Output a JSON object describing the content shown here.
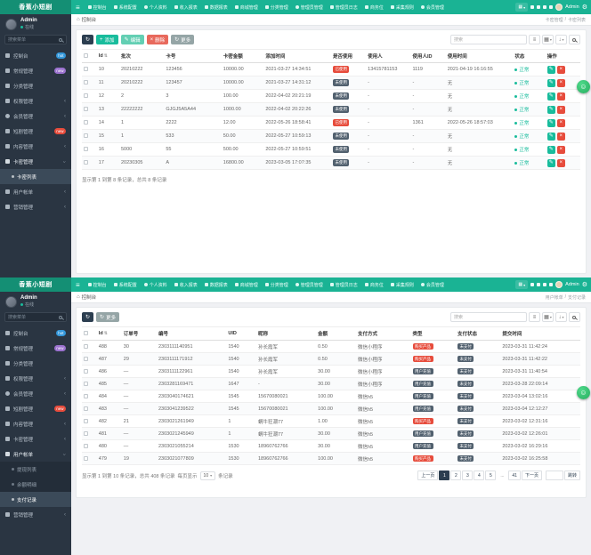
{
  "brand": "香蕉小短剧",
  "theme": {
    "header_teal": "#1ab394",
    "brand_dark": "#148f74",
    "sidebar_dark": "#2a3542",
    "accent_green": "#18bc9c",
    "danger_red": "#e74c3c",
    "navy": "#2c3e50",
    "gray_button": "#95a5a6",
    "badge_blue": "#3498db",
    "badge_purple": "#9b72cf",
    "badge_dark": "#51606e"
  },
  "icons": {
    "chevron": "‹",
    "sort": "⇅",
    "refresh": "↻",
    "plus": "+",
    "pencil": "✎",
    "close": "×",
    "trash": "×",
    "toggle": "≡",
    "columns": "▦",
    "export": "↓",
    "caret": "▾",
    "home": "⌂",
    "gear": "⚙",
    "grid": "▦",
    "smile": "☺",
    "collapse": "≡"
  },
  "topnav": {
    "items": [
      {
        "icon": "home",
        "label": "控制台"
      },
      {
        "icon": "gear",
        "label": "系统配置"
      },
      {
        "icon": "user",
        "label": "个人资料",
        "round": true
      },
      {
        "icon": "chart",
        "label": "收入报表"
      },
      {
        "icon": "chart",
        "label": "数据报表"
      },
      {
        "icon": "bag",
        "label": "商城管理"
      },
      {
        "icon": "tag",
        "label": "分类管理"
      },
      {
        "icon": "admin",
        "label": "管理员管理",
        "round": true
      },
      {
        "icon": "log",
        "label": "管理员日志"
      },
      {
        "icon": "briefcase",
        "label": "商务位"
      },
      {
        "icon": "rules",
        "label": "采集规则"
      },
      {
        "icon": "member",
        "label": "会员管理",
        "round": true
      }
    ],
    "right_icons": [
      "bell",
      "envelope",
      "message",
      "fullscreen"
    ],
    "user": "Admin"
  },
  "sidebar": {
    "user": "Admin",
    "status": "在线",
    "search_placeholder": "搜索菜单"
  },
  "screens": [
    {
      "breadcrumb_left": "控制台",
      "breadcrumb_right": [
        "卡密管理",
        "卡密列表"
      ],
      "search_placeholder": "搜索",
      "sidebar_items": [
        {
          "icon": "dashboard",
          "label": "控制台",
          "badge": "hot",
          "badge_color": "blue"
        },
        {
          "icon": "gear",
          "label": "常规管理",
          "badge": "new",
          "badge_color": "purple"
        },
        {
          "icon": "send",
          "label": "分类管理"
        },
        {
          "icon": "users",
          "label": "权限管理",
          "chevron": "left"
        },
        {
          "icon": "member",
          "label": "会员管理",
          "chevron": "left",
          "round": true
        },
        {
          "icon": "video",
          "label": "短剧管理",
          "badge": "new",
          "badge_color": "red"
        },
        {
          "icon": "folder",
          "label": "内容管理",
          "chevron": "left"
        },
        {
          "icon": "card",
          "label": "卡密管理",
          "chevron": "down",
          "open": true
        },
        {
          "sub": true,
          "label": "卡密列表",
          "active": true
        },
        {
          "icon": "wallet",
          "label": "用户帐单",
          "chevron": "left"
        },
        {
          "icon": "chart",
          "label": "营销管理",
          "chevron": "left"
        }
      ],
      "toolbar": [
        {
          "icon": "refresh",
          "style": "dark"
        },
        {
          "icon": "plus",
          "label": "添加",
          "style": "success"
        },
        {
          "icon": "pencil",
          "label": "编辑",
          "style": "success-lt"
        },
        {
          "icon": "close",
          "label": "删除",
          "style": "danger"
        },
        {
          "icon": "refresh",
          "label": "更多",
          "style": "secondary"
        }
      ],
      "table": {
        "columns": [
          {
            "type": "checkbox",
            "label": "",
            "w": 3
          },
          {
            "label": "Id",
            "w": 4.5,
            "sort": true
          },
          {
            "label": "批次",
            "w": 9
          },
          {
            "label": "卡号",
            "w": 11.5
          },
          {
            "label": "卡密金额",
            "w": 8.5
          },
          {
            "label": "添加时间",
            "w": 13.5
          },
          {
            "label": "是否使用",
            "w": 7
          },
          {
            "label": "使用人",
            "w": 9
          },
          {
            "label": "使用人ID",
            "w": 7
          },
          {
            "label": "使用时间",
            "w": 13.5
          },
          {
            "label": "状态",
            "w": 6.5
          },
          {
            "label": "操作",
            "w": 7
          }
        ],
        "fields": [
          {
            "type": "checkbox"
          },
          {
            "key": "id"
          },
          {
            "key": "batch"
          },
          {
            "key": "card_no"
          },
          {
            "key": "amount"
          },
          {
            "key": "added"
          },
          {
            "type": "badge",
            "key": "used",
            "color": "used_color"
          },
          {
            "key": "user"
          },
          {
            "key": "user_id"
          },
          {
            "key": "use_time"
          },
          {
            "type": "status",
            "key": "status"
          },
          {
            "type": "actions"
          }
        ],
        "rows": [
          {
            "id": "10",
            "batch": "20210222",
            "card_no": "123456",
            "amount": "10000.00",
            "added": "2021-03-27 14:34:51",
            "used": "已使用",
            "used_color": "red",
            "user": "13415781153",
            "user_id": "1119",
            "use_time": "2021-04-19 16:16:55",
            "status": "正常"
          },
          {
            "id": "11",
            "batch": "20210222",
            "card_no": "123457",
            "amount": "10000.00",
            "added": "2021-03-27 14:31:12",
            "used": "未使用",
            "used_color": "dark",
            "user": "-",
            "user_id": "-",
            "use_time": "无",
            "status": "正常"
          },
          {
            "id": "12",
            "batch": "2",
            "card_no": "3",
            "amount": "100.00",
            "added": "2022-04-02 20:21:19",
            "used": "未使用",
            "used_color": "dark",
            "user": "-",
            "user_id": "-",
            "use_time": "无",
            "status": "正常"
          },
          {
            "id": "13",
            "batch": "22222222",
            "card_no": "GJGJ5A5A44",
            "amount": "1000.00",
            "added": "2022-04-02 20:22:26",
            "used": "未使用",
            "used_color": "dark",
            "user": "-",
            "user_id": "-",
            "use_time": "无",
            "status": "正常"
          },
          {
            "id": "14",
            "batch": "1",
            "card_no": "2222",
            "amount": "12.00",
            "added": "2022-05-26 18:58:41",
            "used": "已使用",
            "used_color": "red",
            "user": "-",
            "user_id": "1361",
            "use_time": "2022-05-26 18:57:03",
            "status": "正常"
          },
          {
            "id": "15",
            "batch": "1",
            "card_no": "533",
            "amount": "50.00",
            "added": "2022-05-27 10:59:13",
            "used": "未使用",
            "used_color": "dark",
            "user": "-",
            "user_id": "-",
            "use_time": "无",
            "status": "正常"
          },
          {
            "id": "16",
            "batch": "5000",
            "card_no": "55",
            "amount": "500.00",
            "added": "2022-05-27 10:59:51",
            "used": "未使用",
            "used_color": "dark",
            "user": "-",
            "user_id": "-",
            "use_time": "无",
            "status": "正常"
          },
          {
            "id": "17",
            "batch": "20230305",
            "card_no": "A",
            "amount": "16800.00",
            "added": "2023-03-05 17:07:35",
            "used": "未使用",
            "used_color": "dark",
            "user": "-",
            "user_id": "-",
            "use_time": "无",
            "status": "正常"
          }
        ]
      },
      "footer_text": "显示第 1 到第 8 条记录，总共 8 条记录"
    },
    {
      "breadcrumb_left": "控制台",
      "breadcrumb_right": [
        "用户帐单",
        "支付记录"
      ],
      "search_placeholder": "搜索",
      "sidebar_items": [
        {
          "icon": "dashboard",
          "label": "控制台",
          "badge": "hot",
          "badge_color": "blue"
        },
        {
          "icon": "gear",
          "label": "常规管理",
          "badge": "new",
          "badge_color": "purple"
        },
        {
          "icon": "send",
          "label": "分类管理"
        },
        {
          "icon": "users",
          "label": "权限管理",
          "chevron": "left"
        },
        {
          "icon": "member",
          "label": "会员管理",
          "chevron": "left",
          "round": true
        },
        {
          "icon": "video",
          "label": "短剧管理",
          "badge": "new",
          "badge_color": "red"
        },
        {
          "icon": "folder",
          "label": "内容管理",
          "chevron": "left"
        },
        {
          "icon": "card",
          "label": "卡密管理",
          "chevron": "left"
        },
        {
          "icon": "wallet",
          "label": "用户帐单",
          "chevron": "down",
          "open": true
        },
        {
          "sub": true,
          "label": "提现列表"
        },
        {
          "sub": true,
          "label": "余额明细"
        },
        {
          "sub": true,
          "label": "支付记录",
          "active": true
        },
        {
          "icon": "chart",
          "label": "营销管理",
          "chevron": "left"
        }
      ],
      "toolbar": [
        {
          "icon": "refresh",
          "style": "dark"
        },
        {
          "icon": "refresh",
          "label": "更多",
          "style": "secondary"
        }
      ],
      "table": {
        "columns": [
          {
            "type": "checkbox",
            "label": "",
            "w": 3
          },
          {
            "label": "Id",
            "w": 5,
            "sort": true
          },
          {
            "label": "订单号",
            "w": 7
          },
          {
            "label": "编号",
            "w": 14
          },
          {
            "label": "UID",
            "w": 6
          },
          {
            "label": "昵称",
            "w": 12
          },
          {
            "label": "金额",
            "w": 8
          },
          {
            "label": "支付方式",
            "w": 11
          },
          {
            "label": "类型",
            "w": 9
          },
          {
            "label": "支付状态",
            "w": 9
          },
          {
            "label": "提交时间",
            "w": 16
          }
        ],
        "fields": [
          {
            "type": "checkbox"
          },
          {
            "key": "id"
          },
          {
            "key": "order_no"
          },
          {
            "key": "number"
          },
          {
            "key": "uid"
          },
          {
            "key": "nickname"
          },
          {
            "key": "amount"
          },
          {
            "key": "pay_method"
          },
          {
            "type": "badge",
            "key": "type",
            "color": "type_color"
          },
          {
            "type": "badge",
            "key": "pay_status",
            "color": "pay_status_color"
          },
          {
            "key": "submitted"
          }
        ],
        "rows": [
          {
            "id": "488",
            "order_no": "30",
            "number": "2303111140951",
            "uid": "1540",
            "nickname": "孙长霞军",
            "amount": "0.50",
            "pay_method": "微信小程序",
            "type": "购买产品",
            "type_color": "red",
            "pay_status": "未支付",
            "pay_status_color": "dark",
            "submitted": "2023-03-31 11:42:24"
          },
          {
            "id": "487",
            "order_no": "29",
            "number": "2303111171912",
            "uid": "1540",
            "nickname": "孙长霞军",
            "amount": "0.50",
            "pay_method": "微信小程序",
            "type": "购买产品",
            "type_color": "red",
            "pay_status": "未支付",
            "pay_status_color": "dark",
            "submitted": "2023-03-31 11:42:22"
          },
          {
            "id": "486",
            "order_no": "—",
            "number": "2303111122961",
            "uid": "1540",
            "nickname": "孙长霞军",
            "amount": "30.00",
            "pay_method": "微信小程序",
            "type": "用户充值",
            "type_color": "dark",
            "pay_status": "未支付",
            "pay_status_color": "dark",
            "submitted": "2023-03-31 11:40:54"
          },
          {
            "id": "485",
            "order_no": "—",
            "number": "2303281169471",
            "uid": "1647",
            "nickname": "-",
            "amount": "30.00",
            "pay_method": "微信小程序",
            "type": "用户充值",
            "type_color": "dark",
            "pay_status": "未支付",
            "pay_status_color": "dark",
            "submitted": "2023-03-28 22:09:14"
          },
          {
            "id": "484",
            "order_no": "—",
            "number": "2303040174621",
            "uid": "1545",
            "nickname": "15670080021",
            "amount": "100.00",
            "pay_method": "微信h5",
            "type": "用户充值",
            "type_color": "dark",
            "pay_status": "未支付",
            "pay_status_color": "dark",
            "submitted": "2023-03-04 13:02:16"
          },
          {
            "id": "483",
            "order_no": "—",
            "number": "2303041239522",
            "uid": "1545",
            "nickname": "15670080021",
            "amount": "100.00",
            "pay_method": "微信h5",
            "type": "用户充值",
            "type_color": "dark",
            "pay_status": "未支付",
            "pay_status_color": "dark",
            "submitted": "2023-03-04 12:12:27"
          },
          {
            "id": "482",
            "order_no": "21",
            "number": "2303021261949",
            "uid": "1",
            "nickname": "蜗牛狂潮77",
            "amount": "1.00",
            "pay_method": "微信h5",
            "type": "购买产品",
            "type_color": "red",
            "pay_status": "未支付",
            "pay_status_color": "dark",
            "submitted": "2023-03-02 12:31:16"
          },
          {
            "id": "481",
            "order_no": "—",
            "number": "2303021245949",
            "uid": "1",
            "nickname": "蜗牛狂潮77",
            "amount": "30.00",
            "pay_method": "微信h5",
            "type": "用户充值",
            "type_color": "dark",
            "pay_status": "未支付",
            "pay_status_color": "dark",
            "submitted": "2023-03-02 12:26:01"
          },
          {
            "id": "480",
            "order_no": "—",
            "number": "2303021055214",
            "uid": "1530",
            "nickname": "18960762766",
            "amount": "30.00",
            "pay_method": "微信h5",
            "type": "用户充值",
            "type_color": "dark",
            "pay_status": "未支付",
            "pay_status_color": "dark",
            "submitted": "2023-03-02 16:29:16"
          },
          {
            "id": "479",
            "order_no": "19",
            "number": "2303021077809",
            "uid": "1530",
            "nickname": "18960762766",
            "amount": "100.00",
            "pay_method": "微信h5",
            "type": "购买产品",
            "type_color": "red",
            "pay_status": "未支付",
            "pay_status_color": "dark",
            "submitted": "2023-03-02 16:25:58"
          }
        ]
      },
      "footer_text": "显示第 1 到第 10 条记录，总共 408 条记录",
      "page_size_prefix": "每页显示",
      "page_size": "10",
      "page_size_suffix": "条记录",
      "pagination": {
        "prev": "上一页",
        "pages": [
          "1",
          "2",
          "3",
          "4",
          "5",
          "...",
          "41"
        ],
        "active": "1",
        "next": "下一页",
        "jump": "跳转"
      }
    }
  ]
}
